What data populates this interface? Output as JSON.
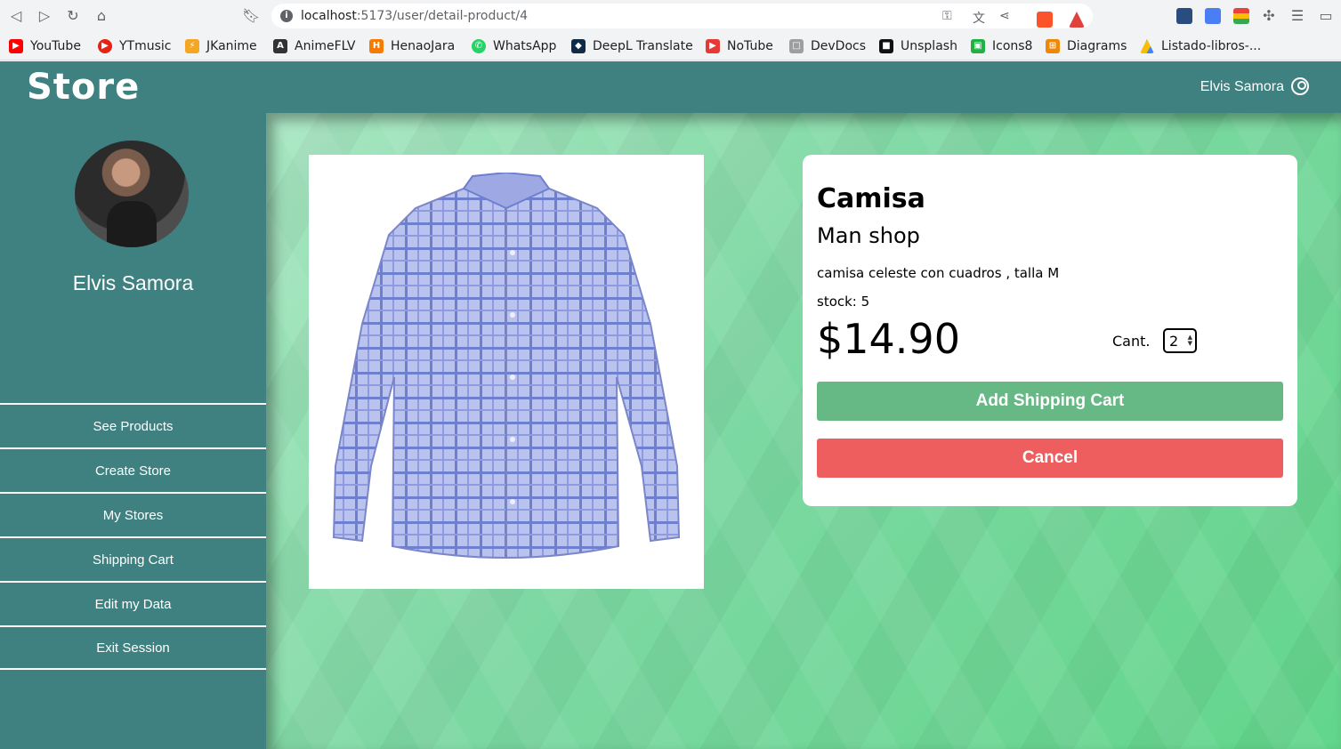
{
  "browser": {
    "url_host": "localhost",
    "url_path": ":5173/user/detail-product/4",
    "bookmarks": [
      {
        "label": "YouTube",
        "icon": "youtube-icon",
        "color": "#ff0000"
      },
      {
        "label": "YTmusic",
        "icon": "ytmusic-icon",
        "color": "#e62117"
      },
      {
        "label": "JKanime",
        "icon": "jkanime-icon",
        "color": "#f5a623"
      },
      {
        "label": "AnimeFLV",
        "icon": "animeflv-icon",
        "color": "#333333"
      },
      {
        "label": "HenaoJara",
        "icon": "henaojara-icon",
        "color": "#f57c00"
      },
      {
        "label": "WhatsApp",
        "icon": "whatsapp-icon",
        "color": "#25d366"
      },
      {
        "label": "DeepL Translate",
        "icon": "deepl-icon",
        "color": "#0f2b46"
      },
      {
        "label": "NoTube",
        "icon": "notube-icon",
        "color": "#e53935"
      },
      {
        "label": "DevDocs",
        "icon": "devdocs-icon",
        "color": "#9e9e9e"
      },
      {
        "label": "Unsplash",
        "icon": "unsplash-icon",
        "color": "#111111"
      },
      {
        "label": "Icons8",
        "icon": "icons8-icon",
        "color": "#1fb141"
      },
      {
        "label": "Diagrams",
        "icon": "diagrams-icon",
        "color": "#f08705"
      },
      {
        "label": "Listado-libros-...",
        "icon": "google-drive-icon",
        "color": "#4285f4"
      }
    ]
  },
  "app": {
    "logo": "Store",
    "header_user": "Elvis Samora"
  },
  "sidebar": {
    "profile_name": "Elvis Samora",
    "items": [
      {
        "label": "See  Products"
      },
      {
        "label": "Create Store"
      },
      {
        "label": "My Stores"
      },
      {
        "label": "Shipping Cart"
      },
      {
        "label": "Edit my  Data"
      },
      {
        "label": "Exit Session"
      }
    ]
  },
  "product": {
    "title": "Camisa",
    "store": "Man shop",
    "description": "camisa celeste con cuadros , talla M",
    "stock": "stock: 5",
    "price": "$14.90",
    "qty_label": "Cant.",
    "qty_value": "2",
    "add_button": "Add Shipping Cart",
    "cancel_button": "Cancel"
  },
  "colors": {
    "primary": "#3f8080",
    "add": "#66b885",
    "cancel": "#ef5e5e"
  }
}
